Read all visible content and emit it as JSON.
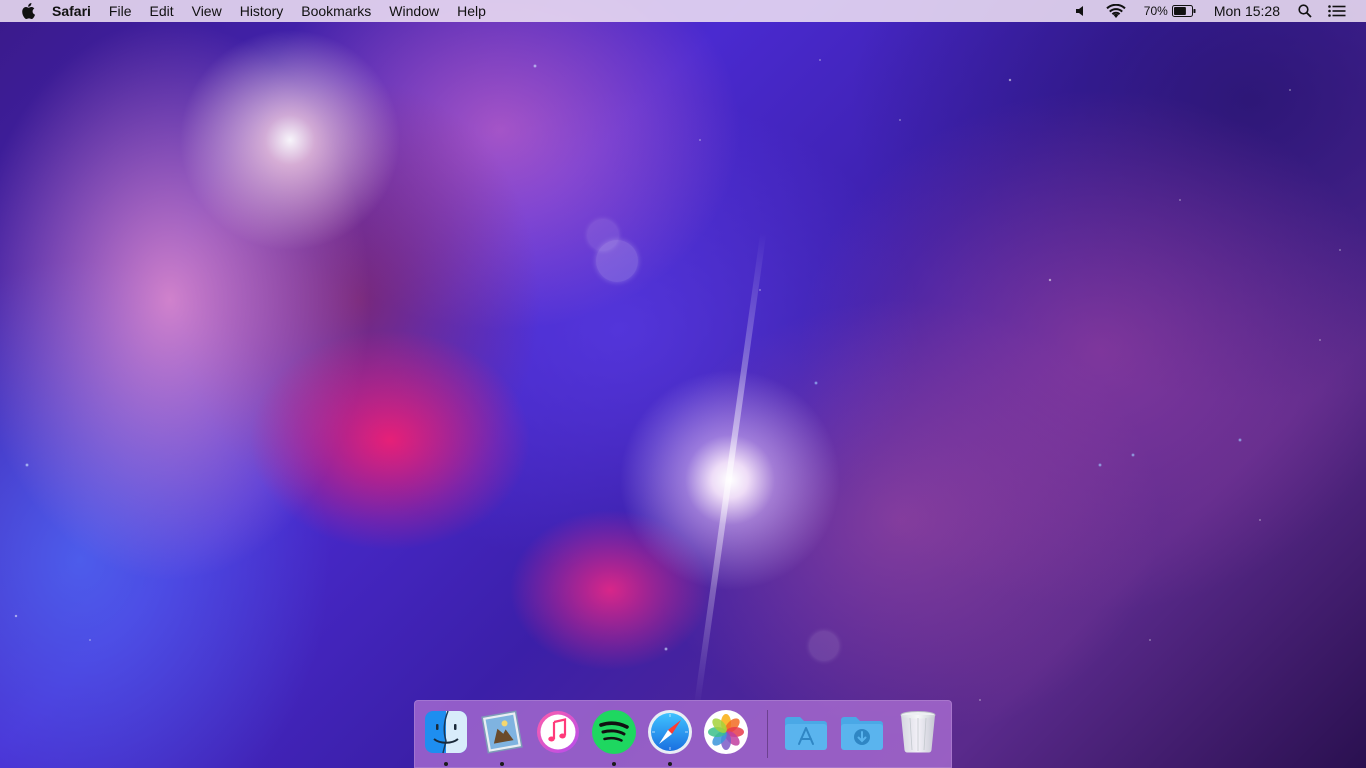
{
  "menubar": {
    "apple_icon": "apple-logo-icon",
    "app_name": "Safari",
    "menus": [
      "File",
      "Edit",
      "View",
      "History",
      "Bookmarks",
      "Window",
      "Help"
    ],
    "status": {
      "volume_icon": "speaker-icon",
      "wifi_icon": "wifi-icon",
      "battery_percent": "70%",
      "battery_level": 0.7,
      "battery_icon": "battery-icon",
      "clock": "Mon 15:28",
      "search_icon": "spotlight-search-icon",
      "notifications_icon": "notification-center-icon"
    }
  },
  "dock": {
    "items": [
      {
        "icon": "finder-icon",
        "running": true
      },
      {
        "icon": "mail-icon",
        "running": true
      },
      {
        "icon": "itunes-icon",
        "running": false
      },
      {
        "icon": "spotify-icon",
        "running": true
      },
      {
        "icon": "safari-icon",
        "running": true
      },
      {
        "icon": "photos-icon",
        "running": false
      },
      {
        "icon": "applications-folder-icon",
        "running": false
      },
      {
        "icon": "downloads-folder-icon",
        "running": false
      },
      {
        "icon": "trash-icon",
        "running": false
      }
    ]
  },
  "colors": {
    "menubar_bg": "#ecdef2",
    "dock_bg": "#aa6ed2",
    "spotify_green": "#1ed760",
    "finder_blue": "#1e8ef0",
    "folder_blue": "#5ab4ee"
  }
}
